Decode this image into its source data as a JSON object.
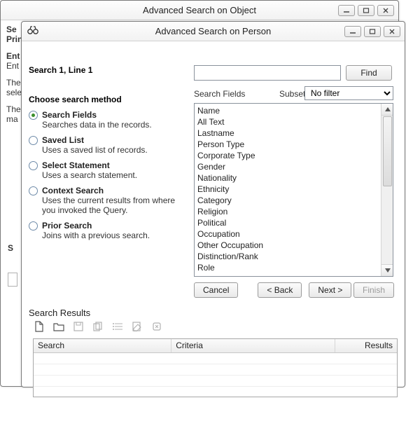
{
  "back_window": {
    "title": "Advanced Search on Object",
    "lines": {
      "a": "Se",
      "b": "Prin",
      "c": "Ent",
      "d": "Ent",
      "e": "The",
      "f": "sele",
      "g": "The",
      "h": "ma"
    },
    "left_s": "S",
    "left_s2": "S"
  },
  "front_window": {
    "title": "Advanced Search on Person",
    "heading": "Search 1, Line 1",
    "search_value": "",
    "find_label": "Find",
    "fields_label": "Search Fields",
    "subset_label": "Subset",
    "subset_value": "No filter",
    "methods_title": "Choose search method",
    "methods": [
      {
        "label": "Search Fields",
        "desc": "Searches data in the records.",
        "checked": true
      },
      {
        "label": "Saved List",
        "desc": "Uses a saved list of records.",
        "checked": false
      },
      {
        "label": "Select Statement",
        "desc": "Uses a search statement.",
        "checked": false
      },
      {
        "label": "Context Search",
        "desc": "Uses the current results from where you invoked the Query.",
        "checked": false
      },
      {
        "label": "Prior Search",
        "desc": "Joins with a previous search.",
        "checked": false
      }
    ],
    "list_items": [
      "Name",
      "All Text",
      "Lastname",
      "Person Type",
      "Corporate Type",
      "Gender",
      "Nationality",
      "Ethnicity",
      "Category",
      "Religion",
      "Political",
      "Occupation",
      "Other Occupation",
      "Distinction/Rank",
      "Role"
    ],
    "buttons": {
      "cancel": "Cancel",
      "back": "< Back",
      "next": "Next >",
      "finish": "Finish"
    },
    "results_title": "Search Results",
    "grid_columns": {
      "search": "Search",
      "criteria": "Criteria",
      "results": "Results"
    }
  }
}
